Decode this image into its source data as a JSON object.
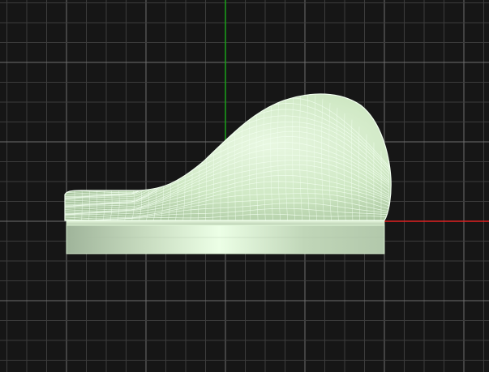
{
  "viewport": {
    "view": "top",
    "grid": true,
    "axes": {
      "x_axis_color": "#e02020",
      "y_axis_color": "#1aa01a"
    },
    "colors": {
      "background": "#161616",
      "grid_minor": "#3c3c3c",
      "grid_major": "#6e6e6e",
      "mesh_fill": "#cfe8c4",
      "mesh_wire": "#f2fff0",
      "base_light": "#dff2d6",
      "base_dark": "#9fb49a"
    },
    "object": {
      "type": "surface-mesh",
      "selected": false
    }
  }
}
